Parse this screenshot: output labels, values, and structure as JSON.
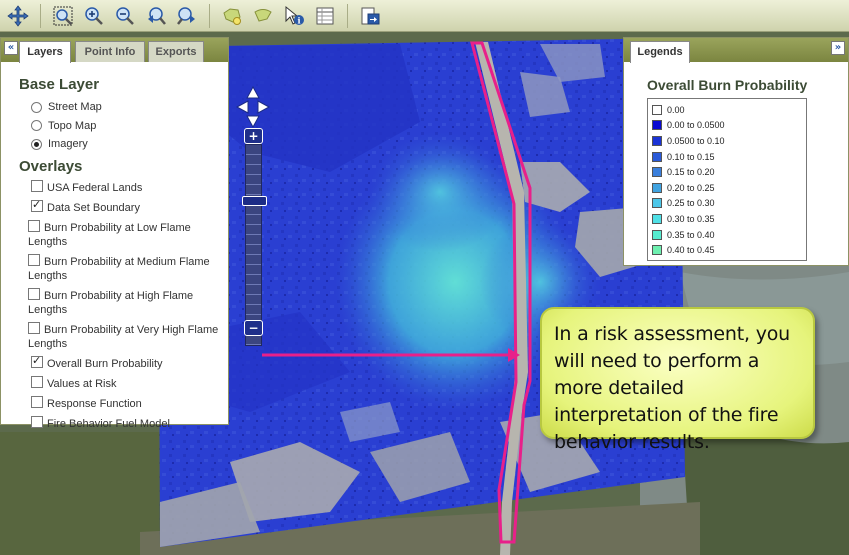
{
  "toolbar": {
    "buttons": [
      "pan-icon",
      "zoom-extent-icon",
      "zoom-in-icon",
      "zoom-out-icon",
      "previous-extent-icon",
      "next-extent-icon",
      "draw-polygon-icon",
      "draw-shape-icon",
      "identify-icon",
      "table-icon",
      "export-icon"
    ]
  },
  "left_panel": {
    "tabs": [
      {
        "label": "Layers",
        "active": true
      },
      {
        "label": "Point Info",
        "active": false
      },
      {
        "label": "Exports",
        "active": false
      }
    ],
    "base_layer_heading": "Base Layer",
    "base_layers": [
      {
        "label": "Street Map",
        "selected": false
      },
      {
        "label": "Topo Map",
        "selected": false
      },
      {
        "label": "Imagery",
        "selected": true
      }
    ],
    "overlays_heading": "Overlays",
    "overlays": [
      {
        "label": "USA Federal Lands",
        "checked": false
      },
      {
        "label": "Data Set Boundary",
        "checked": true
      },
      {
        "label": "Burn Probability at Low Flame Lengths",
        "checked": false
      },
      {
        "label": "Burn Probability at Medium Flame Lengths",
        "checked": false
      },
      {
        "label": "Burn Probability at High Flame Lengths",
        "checked": false
      },
      {
        "label": "Burn Probability at Very High Flame Lengths",
        "checked": false
      },
      {
        "label": "Overall Burn Probability",
        "checked": true
      },
      {
        "label": "Values at Risk",
        "checked": false
      },
      {
        "label": "Response Function",
        "checked": false
      },
      {
        "label": "Fire Behavior Fuel Model",
        "checked": false
      }
    ]
  },
  "right_panel": {
    "tab": "Legends",
    "legend_title": "Overall Burn Probability",
    "legend": [
      {
        "label": "0.00",
        "color": "#ffffff"
      },
      {
        "label": "0.00 to 0.0500",
        "color": "#0a0ad2"
      },
      {
        "label": "0.0500 to 0.10",
        "color": "#1a33d6"
      },
      {
        "label": "0.10 to 0.15",
        "color": "#2a5ad8"
      },
      {
        "label": "0.15 to 0.20",
        "color": "#3a7fdc"
      },
      {
        "label": "0.20 to 0.25",
        "color": "#40a3e0"
      },
      {
        "label": "0.25 to 0.30",
        "color": "#4cc6e8"
      },
      {
        "label": "0.30 to 0.35",
        "color": "#4fe0e6"
      },
      {
        "label": "0.35 to 0.40",
        "color": "#56ecd0"
      },
      {
        "label": "0.40 to 0.45",
        "color": "#6ef0b0"
      }
    ]
  },
  "callout": {
    "text": "In a risk assessment, you will need to perform a more detailed interpretation of the fire behavior results."
  },
  "colors": {
    "highlight": "#e8208a",
    "panel_header": "#8c9650",
    "heading_text": "#3c4b35"
  }
}
